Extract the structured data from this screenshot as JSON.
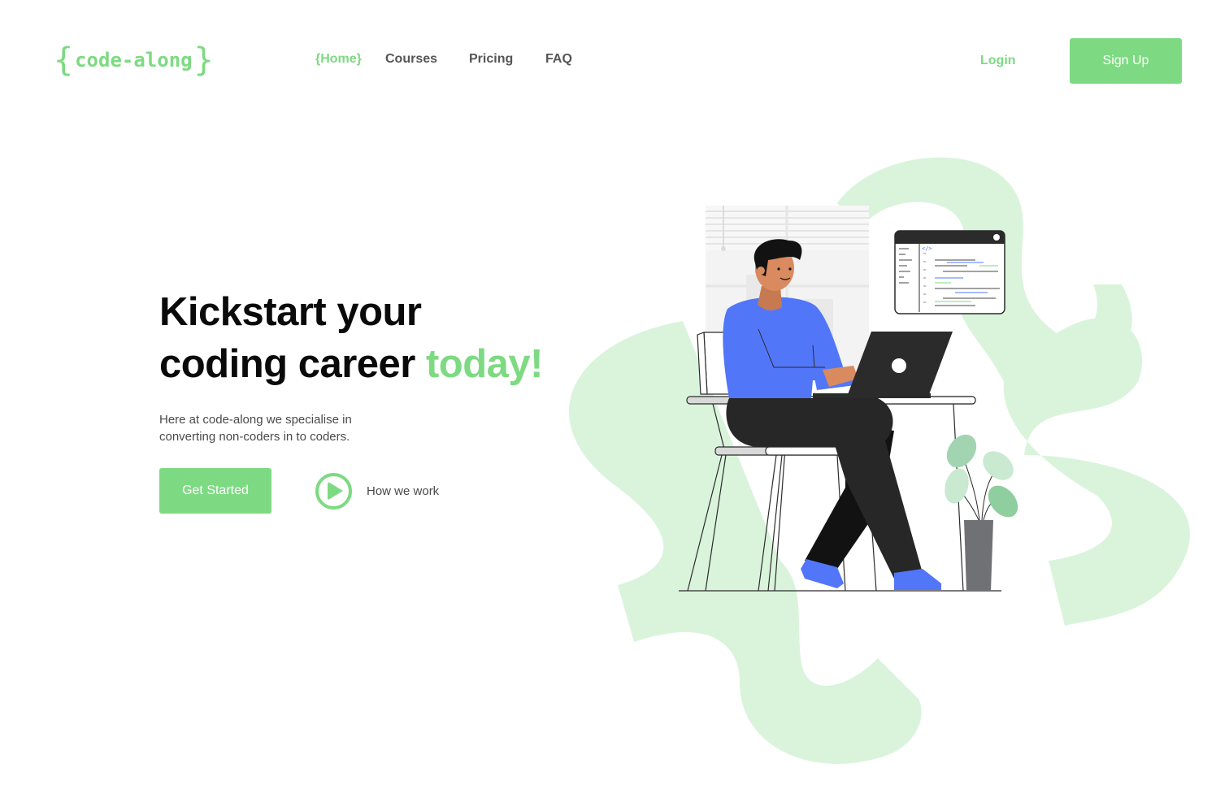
{
  "header": {
    "logo": {
      "open_brace": "{",
      "word": "code-along",
      "close_brace": "}"
    },
    "nav": [
      {
        "label": "{Home}",
        "active": true
      },
      {
        "label": "Courses",
        "active": false
      },
      {
        "label": "Pricing",
        "active": false
      },
      {
        "label": "FAQ",
        "active": false
      }
    ],
    "login_label": "Login",
    "signup_label": "Sign Up"
  },
  "hero": {
    "title_line1": "Kickstart your",
    "title_line2": "coding career ",
    "title_accent": "today!",
    "subtitle": "Here at code-along we specialise in converting non-coders in to coders.",
    "cta_label": "Get Started",
    "secondary_label": "How we work"
  },
  "illustration": {
    "code_window_tag": "</>"
  },
  "colors": {
    "accent": "#7dda82",
    "blob": "#daf4dc",
    "shirt": "#5276f8",
    "pants": "#272727"
  }
}
